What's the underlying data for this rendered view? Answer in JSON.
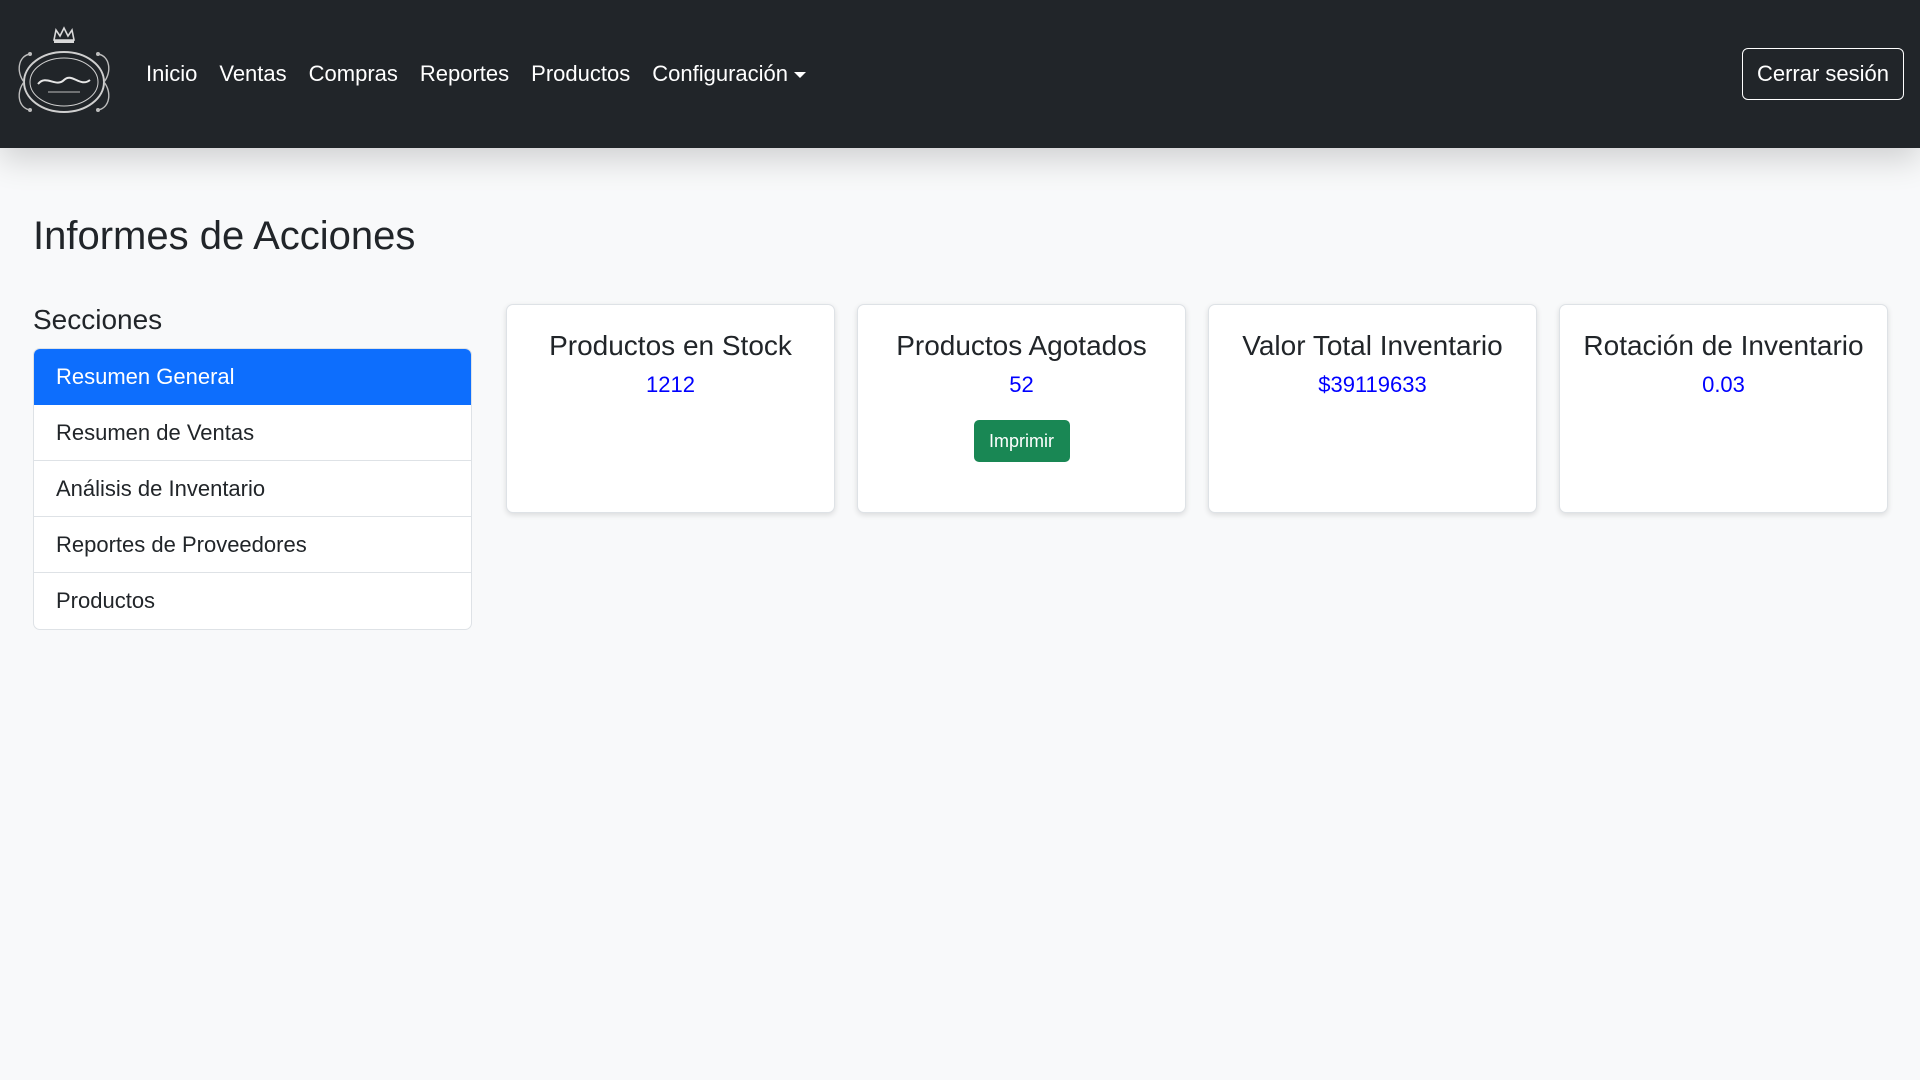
{
  "navbar": {
    "brand_logo": "francheska-logo",
    "links": [
      "Inicio",
      "Ventas",
      "Compras",
      "Reportes",
      "Productos"
    ],
    "config_label": "Configuración",
    "logout_label": "Cerrar sesión"
  },
  "page": {
    "title": "Informes de Acciones",
    "sections_title": "Secciones"
  },
  "sections": [
    {
      "label": "Resumen General",
      "active": true
    },
    {
      "label": "Resumen de Ventas",
      "active": false
    },
    {
      "label": "Análisis de Inventario",
      "active": false
    },
    {
      "label": "Reportes de Proveedores",
      "active": false
    },
    {
      "label": "Productos",
      "active": false
    }
  ],
  "cards": [
    {
      "title": "Productos en Stock",
      "value": "1212"
    },
    {
      "title": "Productos Agotados",
      "value": "52",
      "button": "Imprimir"
    },
    {
      "title": "Valor Total Inventario",
      "value": "$39119633"
    },
    {
      "title": "Rotación de Inventario",
      "value": "0.03"
    }
  ],
  "colors": {
    "navbar_bg": "#212529",
    "active_item": "#0d6efd",
    "value_text": "#0000ff",
    "print_button": "#198754"
  }
}
